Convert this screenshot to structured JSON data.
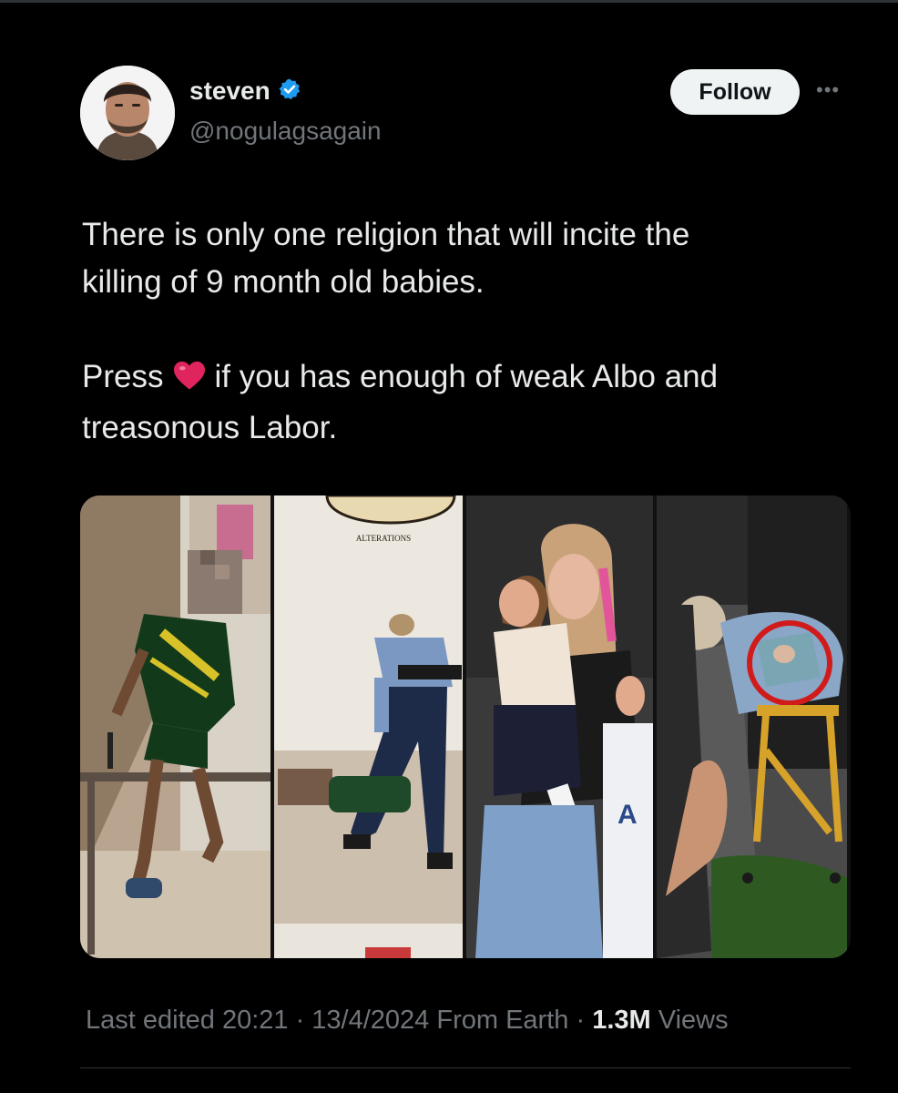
{
  "author": {
    "name": "steven",
    "handle": "@nogulagsagain",
    "verified": true
  },
  "actions": {
    "follow_label": "Follow"
  },
  "tweet": {
    "line1": "There is only one religion that will incite the",
    "line2": "killing of 9 month old babies.",
    "press_word": "Press",
    "press_rest": "if you has enough of weak Albo and",
    "line4": "treasonous Labor."
  },
  "media": {
    "images": [
      {
        "sign_text": ""
      },
      {
        "sign_text": "ALTERATIONS"
      },
      {
        "sign_text": ""
      },
      {
        "sign_text": ""
      }
    ]
  },
  "meta": {
    "edited": "Last edited 20:21 · 13/4/2024",
    "source": "From Earth",
    "separator": "·",
    "views_count": "1.3M",
    "views_label": "Views"
  },
  "colors": {
    "background": "#000000",
    "verified_badge": "#1d9bf0",
    "muted_text": "#71767b",
    "heart": "#e0245e"
  },
  "icons": {
    "verified": "verified-badge-icon",
    "more": "more-options-icon",
    "heart": "red-heart-emoji"
  }
}
